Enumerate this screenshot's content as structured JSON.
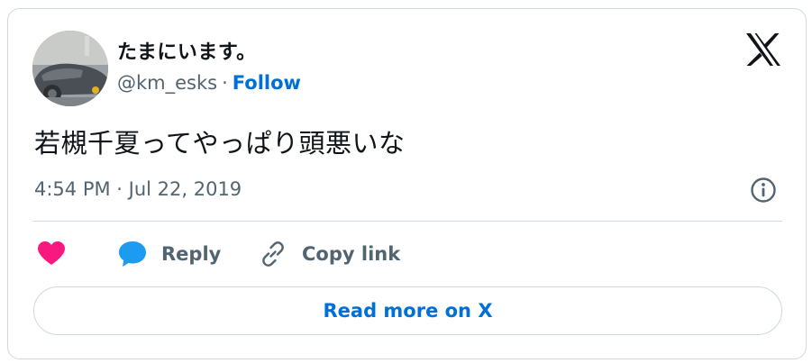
{
  "user": {
    "display_name": "たまにいます。",
    "handle": "@km_esks",
    "separator": "·",
    "follow_label": "Follow"
  },
  "tweet": {
    "text": "若槻千夏ってやっぱり頭悪いな",
    "timestamp": "4:54 PM · Jul 22, 2019"
  },
  "actions": {
    "like_icon": "heart-icon",
    "reply_icon": "speech-bubble-icon",
    "reply_label": "Reply",
    "copy_icon": "link-icon",
    "copy_label": "Copy link"
  },
  "read_more_label": "Read more on X",
  "colors": {
    "link_blue": "#006fd6",
    "like_pink": "#f91880",
    "reply_blue": "#1d9bf0",
    "muted_text": "#536471",
    "border": "#cfd9de"
  }
}
